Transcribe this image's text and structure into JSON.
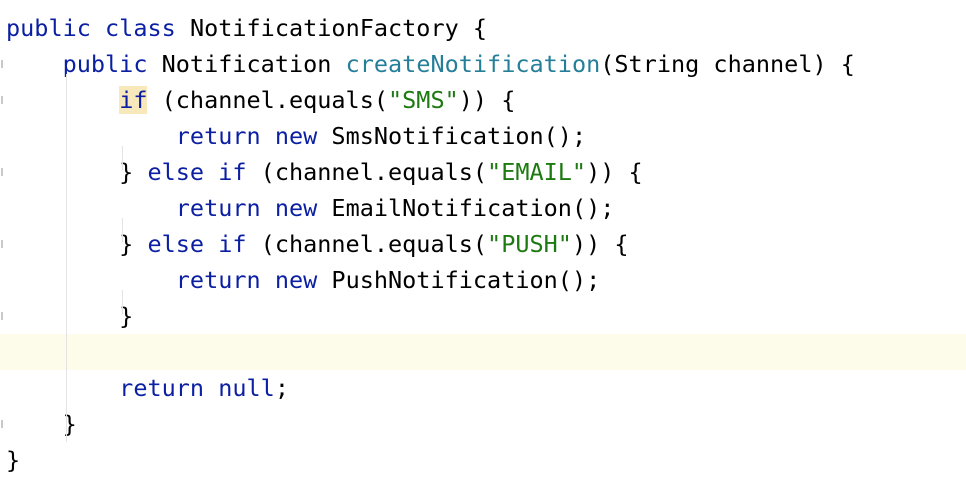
{
  "editor": {
    "lines": [
      {
        "tokens": [
          {
            "t": "kw",
            "v": "public class "
          },
          {
            "t": "plain",
            "v": "NotificationFactory {"
          }
        ]
      },
      {
        "tokens": [
          {
            "t": "kw",
            "v": "    public "
          },
          {
            "t": "plain",
            "v": "Notification "
          },
          {
            "t": "fn",
            "v": "createNotification"
          },
          {
            "t": "plain",
            "v": "(String channel) {"
          }
        ]
      },
      {
        "tokens": [
          {
            "t": "plain",
            "v": "        "
          },
          {
            "t": "kw-match",
            "v": "if"
          },
          {
            "t": "plain",
            "v": " (channel.equals("
          },
          {
            "t": "str",
            "v": "\"SMS\""
          },
          {
            "t": "plain",
            "v": ")) {"
          }
        ]
      },
      {
        "tokens": [
          {
            "t": "kw",
            "v": "            return new "
          },
          {
            "t": "plain",
            "v": "SmsNotification();"
          }
        ]
      },
      {
        "tokens": [
          {
            "t": "plain",
            "v": "        } "
          },
          {
            "t": "kw",
            "v": "else if "
          },
          {
            "t": "plain",
            "v": "(channel.equals("
          },
          {
            "t": "str",
            "v": "\"EMAIL\""
          },
          {
            "t": "plain",
            "v": ")) {"
          }
        ]
      },
      {
        "tokens": [
          {
            "t": "kw",
            "v": "            return new "
          },
          {
            "t": "plain",
            "v": "EmailNotification();"
          }
        ]
      },
      {
        "tokens": [
          {
            "t": "plain",
            "v": "        } "
          },
          {
            "t": "kw",
            "v": "else if "
          },
          {
            "t": "plain",
            "v": "(channel.equals("
          },
          {
            "t": "str",
            "v": "\"PUSH\""
          },
          {
            "t": "plain",
            "v": ")) {"
          }
        ]
      },
      {
        "tokens": [
          {
            "t": "kw",
            "v": "            return new "
          },
          {
            "t": "plain",
            "v": "PushNotification();"
          }
        ]
      },
      {
        "tokens": [
          {
            "t": "plain",
            "v": "        }"
          }
        ]
      },
      {
        "tokens": [],
        "current": true
      },
      {
        "tokens": [
          {
            "t": "kw",
            "v": "        return null"
          },
          {
            "t": "plain",
            "v": ";"
          }
        ]
      },
      {
        "tokens": [
          {
            "t": "plain",
            "v": "    }"
          }
        ]
      },
      {
        "tokens": [
          {
            "t": "plain",
            "v": "}"
          }
        ]
      }
    ]
  },
  "colors": {
    "keyword": "#0b1fa3",
    "method": "#267f99",
    "string": "#1d7a10",
    "current_line": "#fdfbe9",
    "brace_match": "#f7e9bc"
  }
}
